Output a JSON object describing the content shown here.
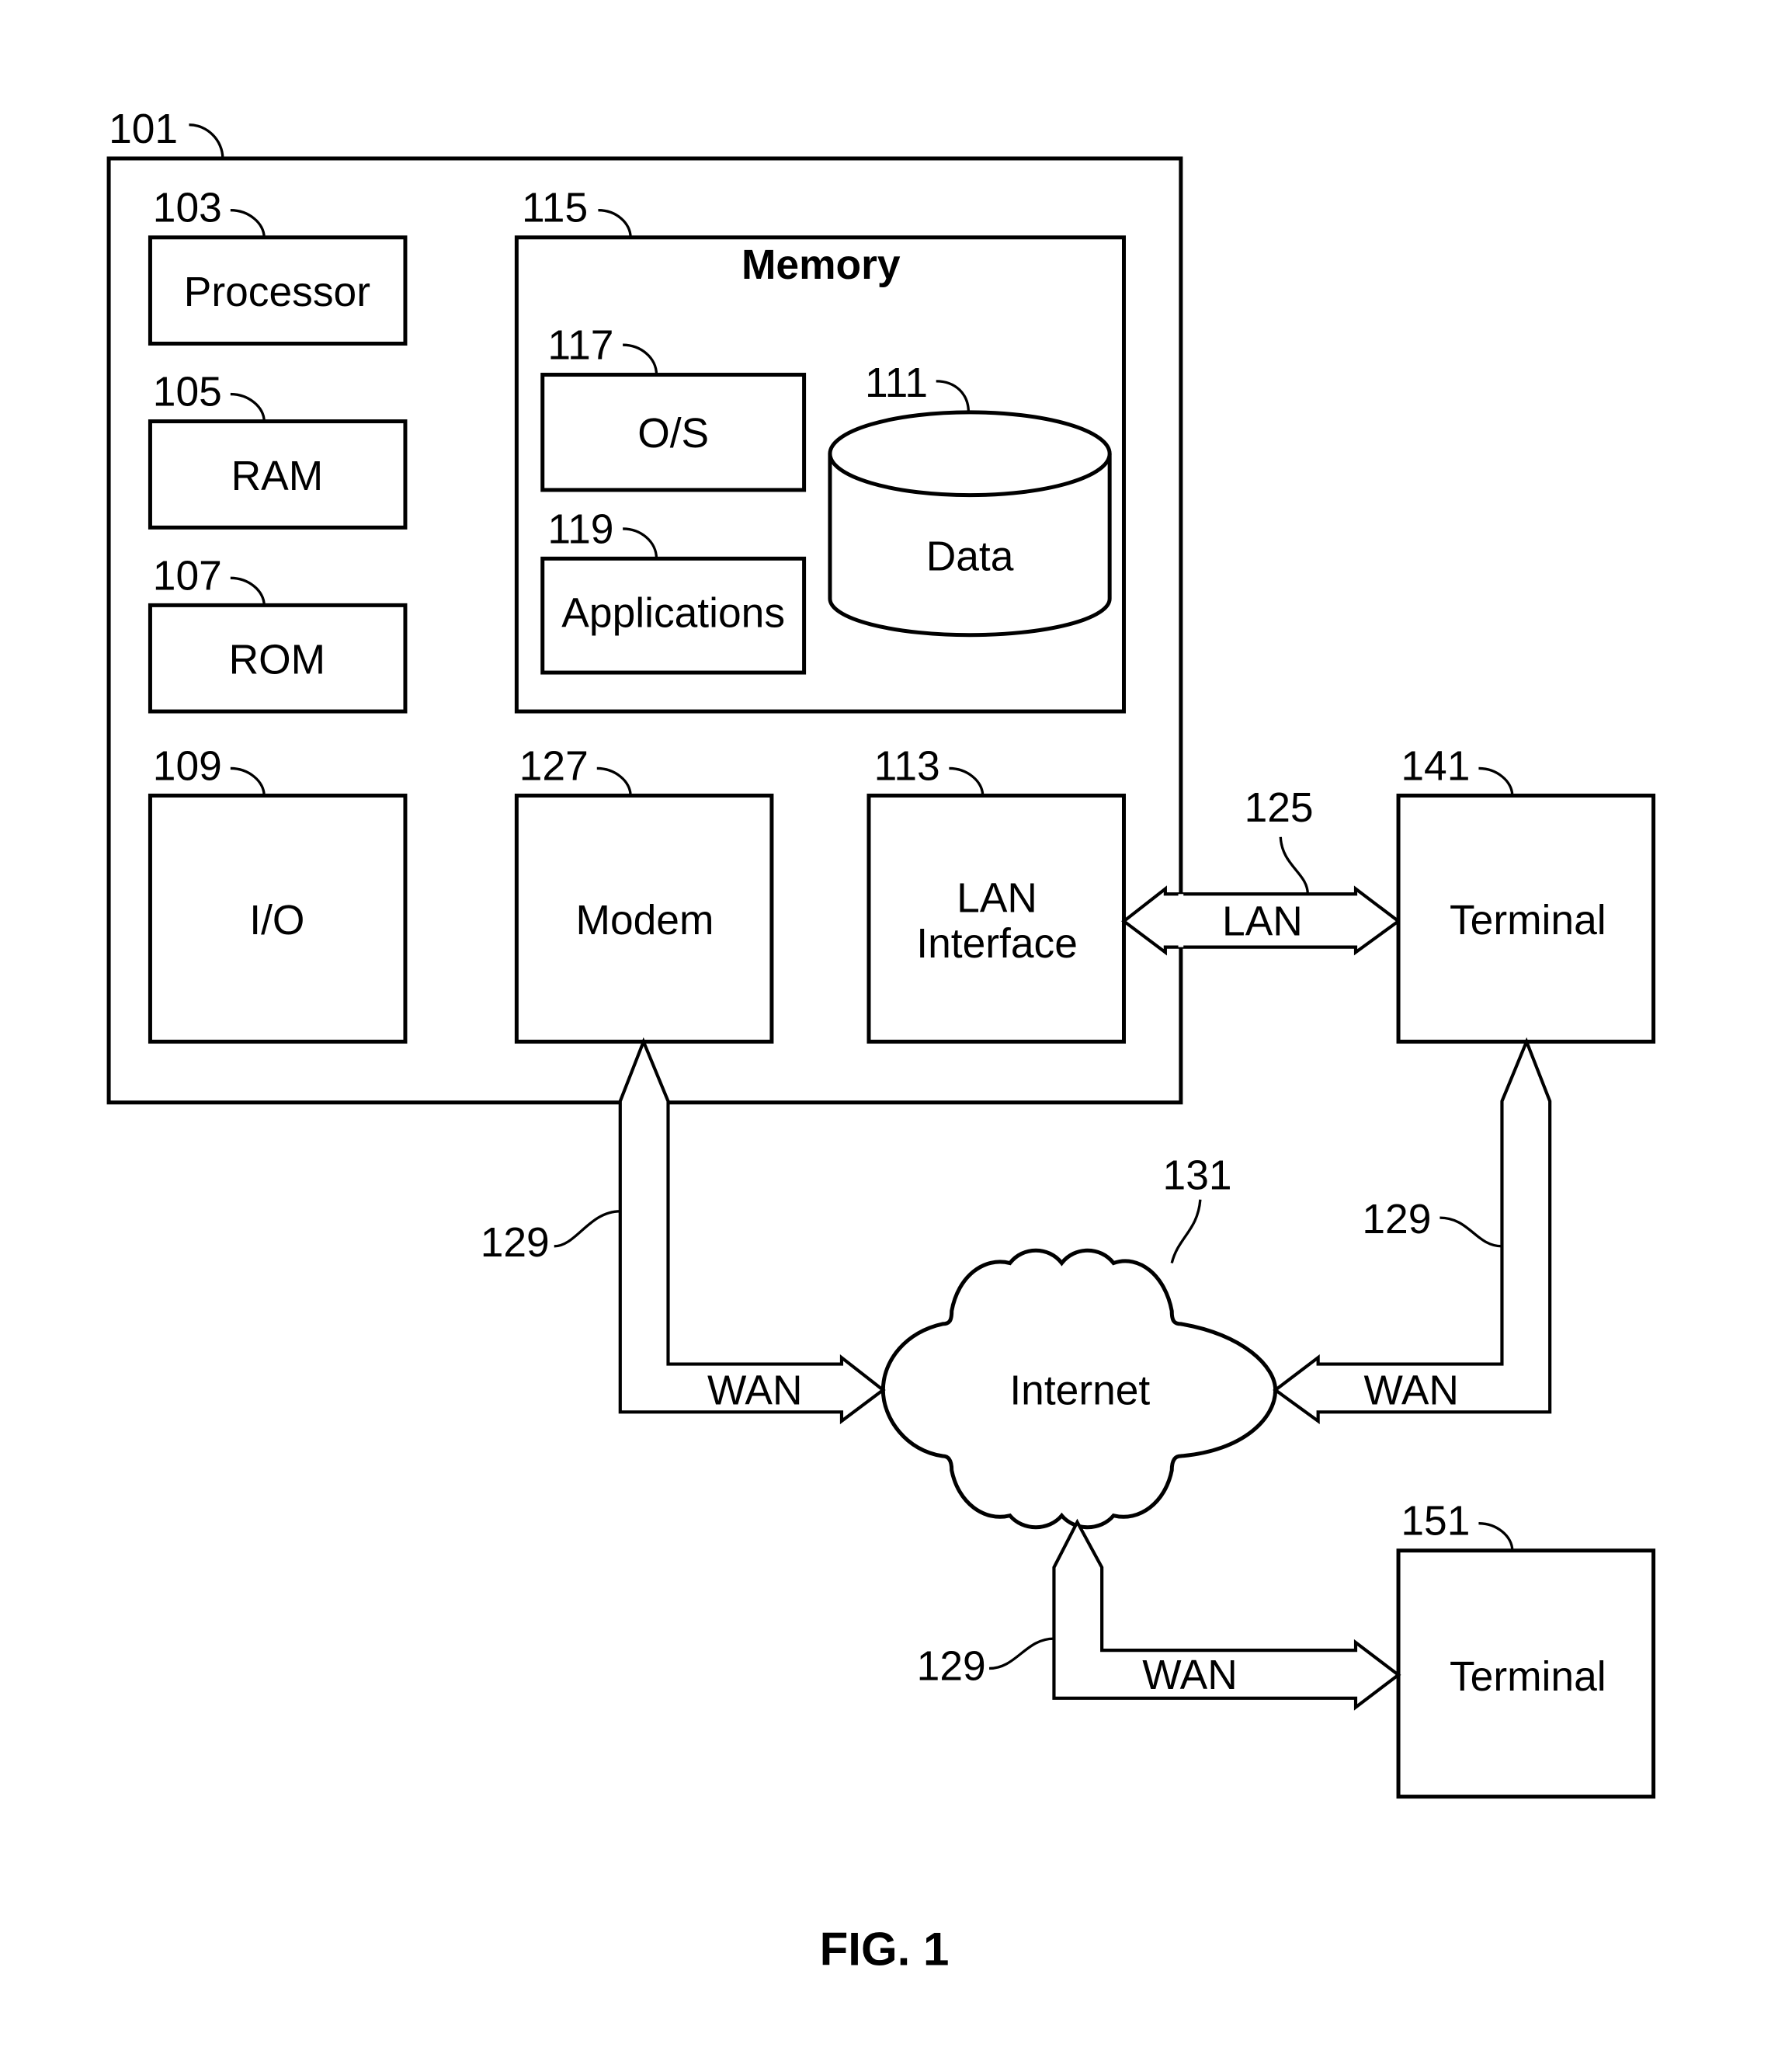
{
  "figure": {
    "caption": "FIG. 1"
  },
  "computer": {
    "ref": "101"
  },
  "processor": {
    "ref": "103",
    "label": "Processor"
  },
  "ram": {
    "ref": "105",
    "label": "RAM"
  },
  "rom": {
    "ref": "107",
    "label": "ROM"
  },
  "io": {
    "ref": "109",
    "label": "I/O"
  },
  "memory": {
    "ref": "115",
    "label": "Memory"
  },
  "os": {
    "ref": "117",
    "label": "O/S"
  },
  "applications": {
    "ref": "119",
    "label": "Applications"
  },
  "data": {
    "ref": "111",
    "label": "Data"
  },
  "modem": {
    "ref": "127",
    "label": "Modem"
  },
  "lan_interface": {
    "ref": "113",
    "label_line1": "LAN",
    "label_line2": "Interface"
  },
  "lan_link": {
    "ref": "125",
    "label": "LAN"
  },
  "terminal_1": {
    "ref": "141",
    "label": "Terminal"
  },
  "terminal_2": {
    "ref": "151",
    "label": "Terminal"
  },
  "internet": {
    "ref": "131",
    "label": "Internet"
  },
  "wan_links": [
    {
      "ref": "129",
      "label": "WAN"
    },
    {
      "ref": "129",
      "label": "WAN"
    },
    {
      "ref": "129",
      "label": "WAN"
    }
  ]
}
